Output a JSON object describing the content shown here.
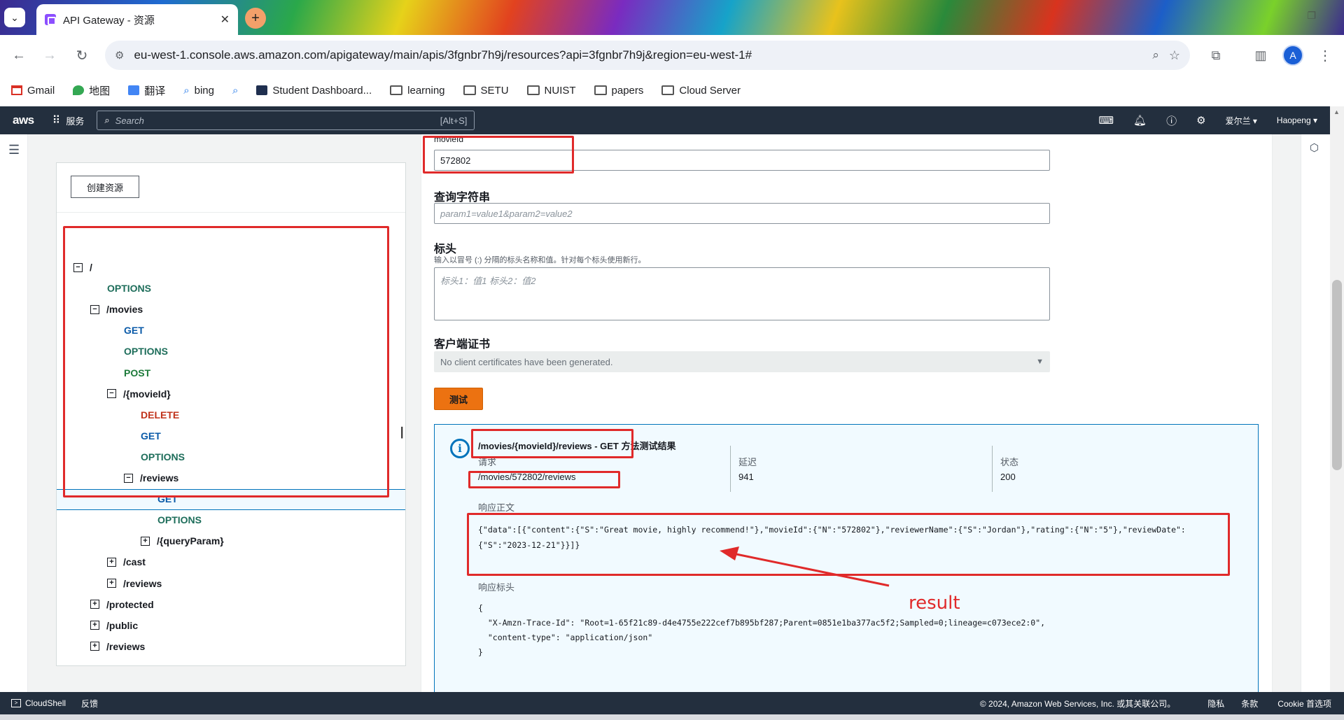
{
  "browser": {
    "tab_title": "API Gateway - 资源",
    "url": "eu-west-1.console.aws.amazon.com/apigateway/main/apis/3fgnbr7h9j/resources?api=3fgnbr7h9j&region=eu-west-1#",
    "profile_initial": "A",
    "bookmarks": [
      {
        "label": "Gmail",
        "icon": "gmail-icon"
      },
      {
        "label": "地图",
        "icon": "maps-icon"
      },
      {
        "label": "翻译",
        "icon": "translate-icon"
      },
      {
        "label": "bing",
        "icon": "search-icon"
      },
      {
        "label": "",
        "icon": "search-icon"
      },
      {
        "label": "Student Dashboard...",
        "icon": "e2-icon"
      },
      {
        "label": "learning",
        "icon": "folder-icon"
      },
      {
        "label": "SETU",
        "icon": "folder-icon"
      },
      {
        "label": "NUIST",
        "icon": "folder-icon"
      },
      {
        "label": "papers",
        "icon": "folder-icon"
      },
      {
        "label": "Cloud Server",
        "icon": "folder-icon"
      }
    ]
  },
  "aws_header": {
    "logo": "aws",
    "services": "服务",
    "search_placeholder": "Search",
    "search_shortcut": "[Alt+S]",
    "region": "爱尔兰 ▾",
    "user": "Haopeng ▾"
  },
  "tree": {
    "create_button": "创建资源",
    "rows": [
      {
        "label": "/",
        "kind": "path",
        "toggle": "−"
      },
      {
        "label": "OPTIONS",
        "kind": "m-options"
      },
      {
        "label": "/movies",
        "kind": "path",
        "toggle": "−"
      },
      {
        "label": "GET",
        "kind": "m-get"
      },
      {
        "label": "OPTIONS",
        "kind": "m-options"
      },
      {
        "label": "POST",
        "kind": "m-post"
      },
      {
        "label": "/{movieId}",
        "kind": "path",
        "toggle": "−"
      },
      {
        "label": "DELETE",
        "kind": "m-delete"
      },
      {
        "label": "GET",
        "kind": "m-get"
      },
      {
        "label": "OPTIONS",
        "kind": "m-options"
      },
      {
        "label": "/reviews",
        "kind": "path",
        "toggle": "−"
      },
      {
        "label": "GET",
        "kind": "m-get"
      },
      {
        "label": "OPTIONS",
        "kind": "m-options"
      },
      {
        "label": "/{queryParam}",
        "kind": "path",
        "toggle": "+"
      },
      {
        "label": "/cast",
        "kind": "path",
        "toggle": "+"
      },
      {
        "label": "/reviews",
        "kind": "path",
        "toggle": "+"
      },
      {
        "label": "/protected",
        "kind": "path",
        "toggle": "+"
      },
      {
        "label": "/public",
        "kind": "path",
        "toggle": "+"
      },
      {
        "label": "/reviews",
        "kind": "path",
        "toggle": "+"
      }
    ]
  },
  "form": {
    "movieid_label": "movieId",
    "movieid_value": "572802",
    "query_label": "查询字符串",
    "query_placeholder": "param1=value1&param2=value2",
    "headers_label": "标头",
    "headers_hint": "输入以冒号 (:) 分隔的标头名称和值。针对每个标头使用新行。",
    "headers_placeholder": "标头1：值1 标头2：值2",
    "cert_label": "客户端证书",
    "cert_value": "No client certificates have been generated.",
    "test_button": "测试"
  },
  "result": {
    "title": "/movies/{movieId}/reviews - GET 方法测试结果",
    "request_label": "请求",
    "request_value": "/movies/572802/reviews",
    "latency_label": "延迟",
    "latency_value": "941",
    "status_label": "状态",
    "status_value": "200",
    "body_label": "响应正文",
    "body_line1": "{\"data\":[{\"content\":{\"S\":\"Great movie, highly recommend!\"},\"movieId\":{\"N\":\"572802\"},\"reviewerName\":{\"S\":\"Jordan\"},\"rating\":{\"N\":\"5\"},\"reviewDate\":",
    "body_line2": "{\"S\":\"2023-12-21\"}}]}",
    "headers_label": "响应标头",
    "headers_line1": "{",
    "headers_line2": "  \"X-Amzn-Trace-Id\": \"Root=1-65f21c89-d4e4755e222cef7b895bf287;Parent=0851e1ba377ac5f2;Sampled=0;lineage=c073ece2:0\",",
    "headers_line3": "  \"content-type\": \"application/json\"",
    "headers_line4": "}"
  },
  "annotation": {
    "label": "result",
    "color": "#e02a2a"
  },
  "footer": {
    "cloudshell": "CloudShell",
    "feedback": "反馈",
    "copyright": "© 2024, Amazon Web Services, Inc. 或其关联公司。",
    "privacy": "隐私",
    "terms": "条款",
    "cookies": "Cookie 首选项"
  }
}
